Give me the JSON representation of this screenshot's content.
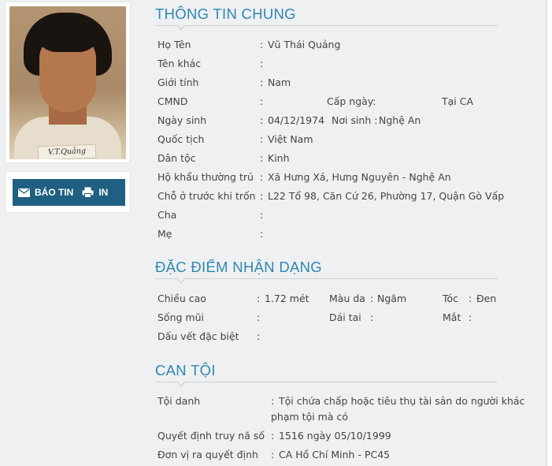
{
  "photo": {
    "caption": "V.T.Quảng"
  },
  "actions": {
    "report_label": "BÁO TIN",
    "print_label": "IN"
  },
  "general": {
    "title": "THÔNG TIN CHUNG",
    "ho_ten_label": "Họ Tên",
    "ho_ten": "Vũ Thái Quảng",
    "ten_khac_label": "Tên khác",
    "ten_khac": "",
    "gioi_tinh_label": "Giới tính",
    "gioi_tinh": "Nam",
    "cmnd_label": "CMND",
    "cmnd": "",
    "cap_ngay_label": "Cấp ngày:",
    "tai_label": "Tại CA",
    "ngay_sinh_label": "Ngày sinh",
    "ngay_sinh": "04/12/1974",
    "noi_sinh_label": "Nơi sinh :",
    "noi_sinh": "Nghệ An",
    "quoc_tich_label": "Quốc tịch",
    "quoc_tich": "Việt Nam",
    "dan_toc_label": "Dân tộc",
    "dan_toc": "Kinh",
    "ho_khau_label": "Hộ khẩu thường trú",
    "ho_khau": "Xã Hưng Xá, Hưng Nguyên - Nghệ An",
    "cho_o_label": "Chỗ ở trước khi trốn",
    "cho_o": "L22 Tổ 98, Căn Cứ 26, Phường 17, Quận Gò Vấp",
    "cha_label": "Cha",
    "cha": "",
    "me_label": "Mẹ",
    "me": ""
  },
  "features": {
    "title": "ĐẶC ĐIỂM NHẬN DẠNG",
    "chieu_cao_label": "Chiều cao",
    "chieu_cao": "1.72 mét",
    "mau_da_label": "Màu da",
    "mau_da": "Ngăm",
    "toc_label": "Tóc",
    "toc": "Đen",
    "song_mui_label": "Sống mũi",
    "song_mui": "",
    "dai_tai_label": "Dái tai",
    "dai_tai": "",
    "mat_label": "Mắt",
    "mat": "",
    "dau_vet_label": "Dấu vết đặc biệt",
    "dau_vet": ""
  },
  "crime": {
    "title": "CAN TỘI",
    "toi_danh_label": "Tội danh",
    "toi_danh_line1": "Tội chứa chấp hoặc tiêu thụ tài sản do người khác",
    "toi_danh_line2": "phạm tội mà có",
    "quyet_dinh_label": "Quyết định truy nã số",
    "quyet_dinh": "1516 ngày 05/10/1999",
    "don_vi_label": "Đơn vị ra quyết định",
    "don_vi": "CA Hồ Chí Minh - PC45"
  }
}
